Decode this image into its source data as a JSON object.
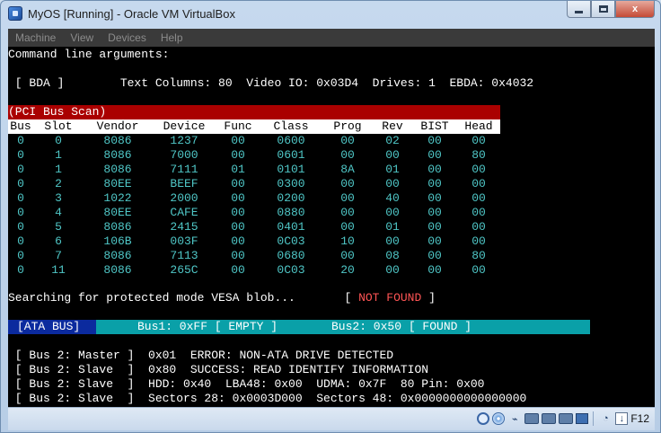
{
  "window": {
    "title": "MyOS [Running] - Oracle VM VirtualBox",
    "buttons": {
      "minimize": "",
      "maximize": "",
      "close": "x"
    }
  },
  "menubar": {
    "items": [
      "Machine",
      "View",
      "Devices",
      "Help"
    ]
  },
  "console": {
    "cmdline_label": "Command line arguments:",
    "bda_line": " [ BDA ]        Text Columns: 80  Video IO: 0x03D4  Drives: 1  EBDA: 0x4032",
    "pci_title": "(PCI Bus Scan)",
    "pci": {
      "columns": [
        "Bus",
        "Slot",
        "Vendor",
        "Device",
        "Func",
        "Class",
        "Prog",
        "Rev",
        "BIST",
        "Head"
      ],
      "rows": [
        [
          "0",
          "0",
          "8086",
          "1237",
          "00",
          "0600",
          "00",
          "02",
          "00",
          "00"
        ],
        [
          "0",
          "1",
          "8086",
          "7000",
          "00",
          "0601",
          "00",
          "00",
          "00",
          "80"
        ],
        [
          "0",
          "1",
          "8086",
          "7111",
          "01",
          "0101",
          "8A",
          "01",
          "00",
          "00"
        ],
        [
          "0",
          "2",
          "80EE",
          "BEEF",
          "00",
          "0300",
          "00",
          "00",
          "00",
          "00"
        ],
        [
          "0",
          "3",
          "1022",
          "2000",
          "00",
          "0200",
          "00",
          "40",
          "00",
          "00"
        ],
        [
          "0",
          "4",
          "80EE",
          "CAFE",
          "00",
          "0880",
          "00",
          "00",
          "00",
          "00"
        ],
        [
          "0",
          "5",
          "8086",
          "2415",
          "00",
          "0401",
          "00",
          "01",
          "00",
          "00"
        ],
        [
          "0",
          "6",
          "106B",
          "003F",
          "00",
          "0C03",
          "10",
          "00",
          "00",
          "00"
        ],
        [
          "0",
          "7",
          "8086",
          "7113",
          "00",
          "0680",
          "00",
          "08",
          "00",
          "80"
        ],
        [
          "0",
          "11",
          "8086",
          "265C",
          "00",
          "0C03",
          "20",
          "00",
          "00",
          "00"
        ]
      ]
    },
    "vesa": {
      "text": "Searching for protected mode VESA blob...       [ ",
      "status": "NOT FOUND",
      "close": " ]"
    },
    "ata": {
      "label": "[ATA BUS]",
      "bus1": "Bus1: 0xFF [ EMPTY ]",
      "bus2": "Bus2: 0x50 [ FOUND ]"
    },
    "drive_lines": [
      " [ Bus 2: Master ]  0x01  ERROR: NON-ATA DRIVE DETECTED",
      " [ Bus 2: Slave  ]  0x80  SUCCESS: READ IDENTIFY INFORMATION",
      " [ Bus 2: Slave  ]  HDD: 0x40  LBA48: 0x00  UDMA: 0x7F  80 Pin: 0x00",
      " [ Bus 2: Slave  ]  Sectors 28: 0x0003D000  Sectors 48: 0x0000000000000000"
    ]
  },
  "statusbar": {
    "icons": [
      "hard-disk-icon",
      "optical-drive-icon",
      "usb-icon",
      "shared-folders-icon",
      "display-icon",
      "video-capture-icon",
      "network-icon",
      "mouse-integration-icon",
      "host-key-arrow-icon"
    ],
    "host_key": "F12"
  }
}
